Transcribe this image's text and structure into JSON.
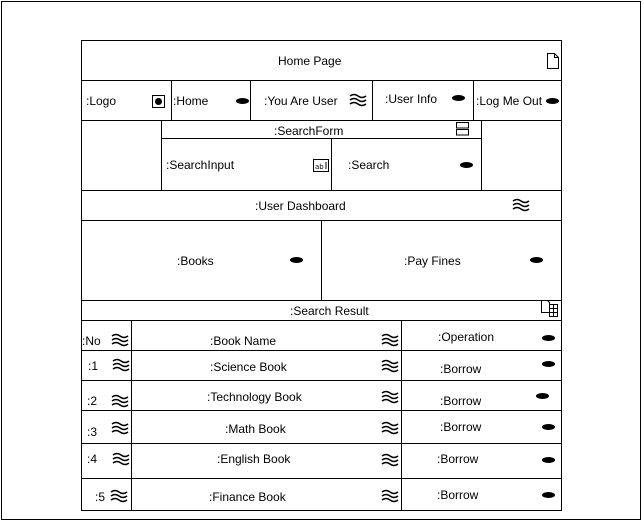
{
  "header": {
    "title": "Home Page",
    "icon": "page-icon"
  },
  "nav": {
    "logo": ":Logo",
    "home": ":Home",
    "you_are_user": ":You Are User",
    "user_info": ":User Info",
    "log_out": ":Log Me Out"
  },
  "search_form": {
    "title": ":SearchForm",
    "input_label": ":SearchInput",
    "button_label": ":Search"
  },
  "dashboard": {
    "title": ":User Dashboard",
    "books": ":Books",
    "pay_fines": ":Pay Fines"
  },
  "search_result": {
    "title": ":Search Result",
    "columns": {
      "no": ":No",
      "book_name": ":Book Name",
      "operation": ":Operation"
    },
    "rows": [
      {
        "no": ":1",
        "name": ":Science Book",
        "op": ":Borrow"
      },
      {
        "no": ":2",
        "name": ":Technology Book",
        "op": ":Borrow"
      },
      {
        "no": ":3",
        "name": ":Math Book",
        "op": ":Borrow"
      },
      {
        "no": ":4",
        "name": ":English Book",
        "op": ":Borrow"
      },
      {
        "no": ":5",
        "name": ":Finance Book",
        "op": ":Borrow"
      }
    ]
  },
  "icons": {
    "button": "oval-button-icon",
    "label": "wave-label-icon",
    "radio": "radio-icon",
    "textfield": "textfield-icon",
    "form": "form-icon",
    "table": "table-icon"
  }
}
